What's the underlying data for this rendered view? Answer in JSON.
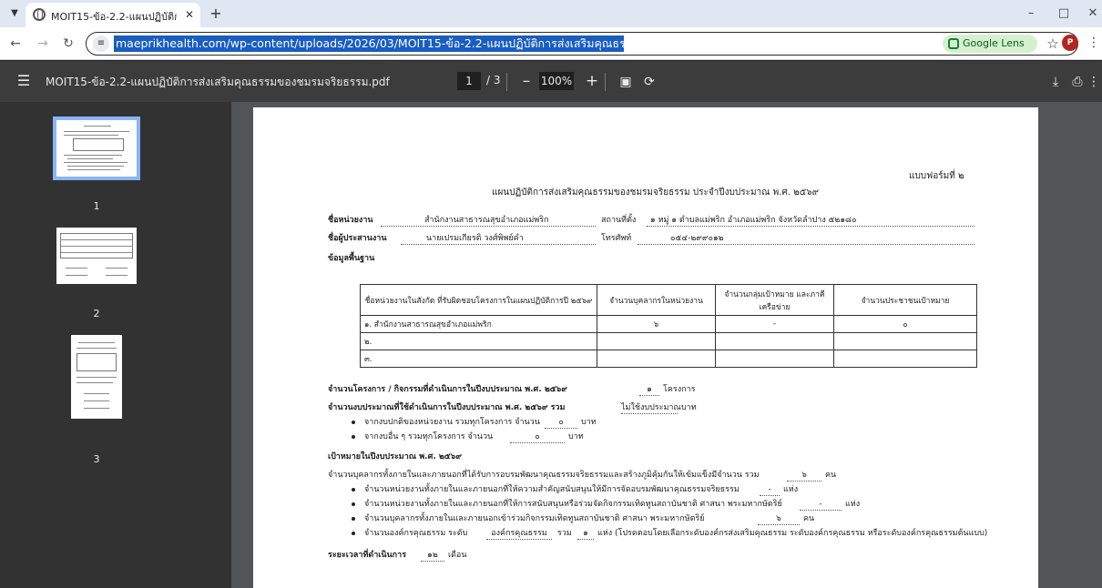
{
  "browser": {
    "tab_title": "MOIT15-ข้อ-2.2-แผนปฏิบัติการส่ง",
    "url": "maeprikhealth.com/wp-content/uploads/2026/03/MOIT15-ข้อ-2.2-แผนปฏิบัติการส่งเสริมคุณธรรมของชมรมจริยธรรม.pdf",
    "lens_label": "Google Lens",
    "profile_initial": "P"
  },
  "viewer": {
    "filename": "MOIT15-ข้อ-2.2-แผนปฏิบัติการส่งเสริมคุณธรรมของชมรมจริยธรรม.pdf",
    "current_page": "1",
    "total_pages": "/ 3",
    "zoom": "100%"
  },
  "thumbnails": [
    "1",
    "2",
    "3"
  ],
  "document": {
    "form_no": "แบบฟอร์มที่ ๒",
    "title": "แผนปฏิบัติการส่งเสริมคุณธรรมของชมรมจริยธรรม ประจำปีงบประมาณ พ.ศ. ๒๕๖๙",
    "unit_label": "ชื่อหน่วยงาน",
    "unit_value": "สำนักงานสาธารณสุขอำเภอแม่พริก",
    "location_label": "สถานที่ตั้ง",
    "location_value": "๑ หมู่ ๑ ตำบลแม่พริก อำเภอแม่พริก จังหวัดลำปาง ๕๒๑๘๐",
    "coordinator_label": "ชื่อผู้ประสานงาน",
    "coordinator_value": "นายเปรมเกียรติ วงศ์พิพย์คำ",
    "phone_label": "โทรศัพท์",
    "phone_value": "๐๕๔-๒๙๙๐๑๒",
    "basic_info": "ข้อมูลพื้นฐาน",
    "table": {
      "headers": [
        "ชื่อหน่วยงานในสังกัด ที่รับผิดชอบโครงการในแผนปฏิบัติการปี ๒๕๖๙",
        "จำนวนบุคลากรในหน่วยงาน",
        "จำนวนกลุ่มเป้าหมาย และภาคีเครือข่าย",
        "จำนวนประชาชนเป้าหมาย"
      ],
      "rows": [
        [
          "๑. สำนักงานสาธารณสุขอำเภอแม่พริก",
          "๖",
          "-",
          "๐"
        ],
        [
          "๒.",
          "",
          "",
          ""
        ],
        [
          "๓.",
          "",
          "",
          ""
        ]
      ]
    },
    "projects_line": "จำนวนโครงการ / กิจกรรมที่ดำเนินการในปีงบประมาณ พ.ศ. ๒๕๖๙",
    "projects_value": "๑",
    "projects_unit": "โครงการ",
    "budget_line": "จำนวนงบประมาณที่ใช้ดำเนินการในปีงบประมาณ พ.ศ. ๒๕๖๙ รวม",
    "budget_value": "ไม่ใช้งบประมาณ",
    "budget_unit": "บาท",
    "budget_sub1": "จากงบปกติของหน่วยงาน รวมทุกโครงการ จำนวน",
    "budget_sub1_value": "๐",
    "budget_sub2": "จากงบอื่น ๆ รวมทุกโครงการ จำนวน",
    "budget_sub2_value": "๐",
    "target_heading": "เป้าหมายในปีงบประมาณ พ.ศ. ๒๕๖๙",
    "target_line": "จำนวนบุคลากรทั้งภายในและภายนอกที่ได้รับการอบรมพัฒนาคุณธรรมจริยธรรมและสร้างภูมิคุ้มกันให้เข้มแข็งมีจำนวน รวม",
    "target_value": "๖",
    "unit_person": "คน",
    "unit_place": "แห่ง",
    "target_sub1": "จำนวนหน่วยงานทั้งภายในและภายนอกที่ให้ความสำคัญสนับสนุนให้มีการจัดอบรมพัฒนาคุณธรรมจริยธรรม",
    "target_sub1_value": "-",
    "target_sub2": "จำนวนหน่วยงานทั้งภายในและภายนอกที่ให้การสนับสนุนหรือร่วมจัดกิจกรรมเทิดทูนสถาบันชาติ ศาสนา พระมหากษัตริย์",
    "target_sub2_value": "-",
    "target_sub3": "จำนวนบุคลากรทั้งภายในและภายนอกเข้าร่วมกิจกรรมเทิดทูนสถาบันชาติ ศาสนา พระมหากษัตริย์",
    "target_sub3_value": "๖",
    "target_sub4_a": "จำนวนองค์กรคุณธรรม ระดับ",
    "target_sub4_level": "องค์กรคุณธรรม",
    "target_sub4_b": "รวม",
    "target_sub4_value": "๑",
    "target_sub4_c": "แห่ง (โปรดตอบโดยเลือกระดับองค์กรส่งเสริมคุณธรรม ระดับองค์กรคุณธรรม หรือระดับองค์กรคุณธรรมต้นแบบ)",
    "duration_label": "ระยะเวลาที่ดำเนินการ",
    "duration_value": "๑๒",
    "duration_unit": "เดือน"
  }
}
